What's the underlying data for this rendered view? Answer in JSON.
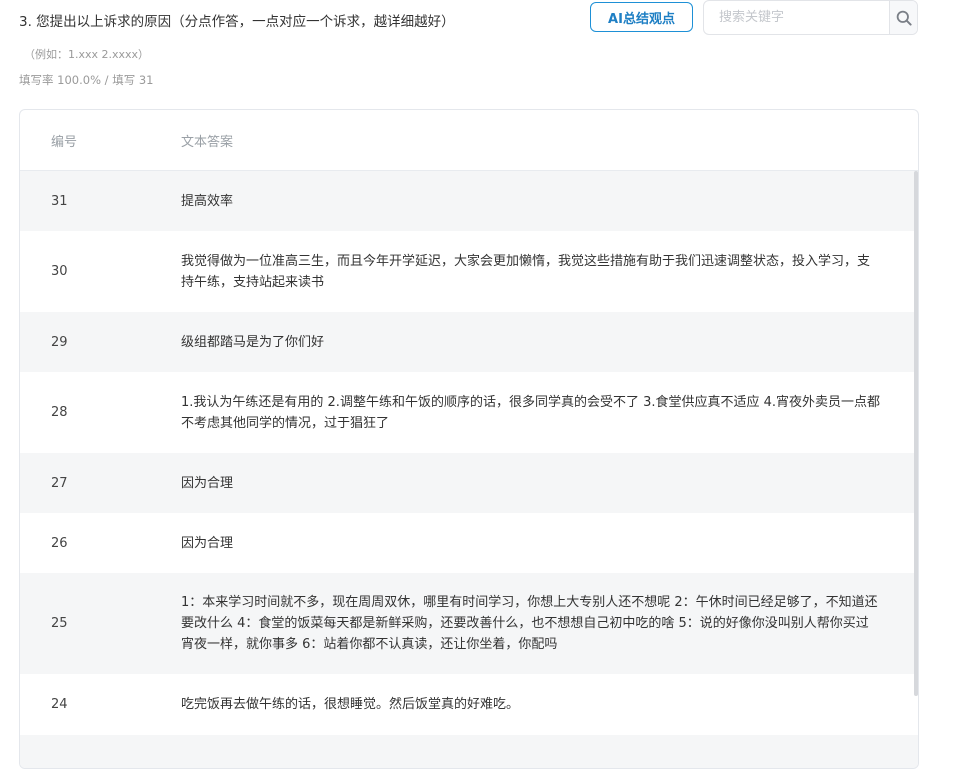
{
  "question": {
    "title": "3. 您提出以上诉求的原因（分点作答，一点对应一个诉求，越详细越好）",
    "hint": "（例如：1.xxx 2.xxxx）",
    "stats": "填写率 100.0% / 填写 31"
  },
  "toolbar": {
    "ai_button_label": "AI总结观点",
    "search_placeholder": "搜索关键字",
    "search_value": ""
  },
  "table": {
    "headers": {
      "id": "编号",
      "text": "文本答案"
    },
    "rows": [
      {
        "id": "31",
        "text": "提高效率"
      },
      {
        "id": "30",
        "text": "我觉得做为一位准高三生，而且今年开学延迟，大家会更加懒惰，我觉这些措施有助于我们迅速调整状态，投入学习，支持午练，支持站起来读书"
      },
      {
        "id": "29",
        "text": "级组都踏马是为了你们好"
      },
      {
        "id": "28",
        "text": "1.我认为午练还是有用的 2.调整午练和午饭的顺序的话，很多同学真的会受不了 3.食堂供应真不适应 4.宵夜外卖员一点都不考虑其他同学的情况，过于猖狂了"
      },
      {
        "id": "27",
        "text": "因为合理"
      },
      {
        "id": "26",
        "text": "因为合理"
      },
      {
        "id": "25",
        "text": "1：本来学习时间就不多，现在周周双休，哪里有时间学习，你想上大专别人还不想呢 2：午休时间已经足够了，不知道还要改什么 4：食堂的饭菜每天都是新鲜采购，还要改善什么，也不想想自己初中吃的啥 5：说的好像你没叫别人帮你买过宵夜一样，就你事多 6：站着你都不认真读，还让你坐着，你配吗"
      },
      {
        "id": "24",
        "text": "吃完饭再去做午练的话，很想睡觉。然后饭堂真的好难吃。"
      },
      {
        "id": "",
        "text": ""
      }
    ]
  }
}
